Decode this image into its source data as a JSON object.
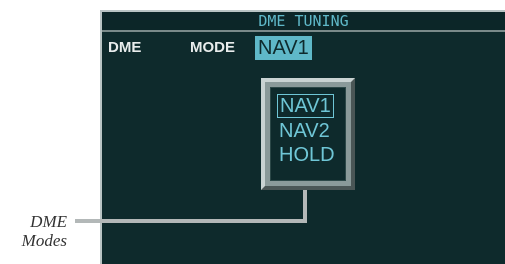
{
  "screen": {
    "title": "DME TUNING",
    "dme_label": "DME",
    "mode_label": "MODE",
    "mode_value": "NAV1"
  },
  "popup": {
    "options": [
      {
        "label": "NAV1",
        "selected": true
      },
      {
        "label": "NAV2",
        "selected": false
      },
      {
        "label": "HOLD",
        "selected": false
      }
    ]
  },
  "callout": {
    "line1": "DME",
    "line2": "Modes"
  },
  "colors": {
    "background": "#0e2a2c",
    "accent": "#5fb8c8",
    "text": "#e8ecec"
  }
}
